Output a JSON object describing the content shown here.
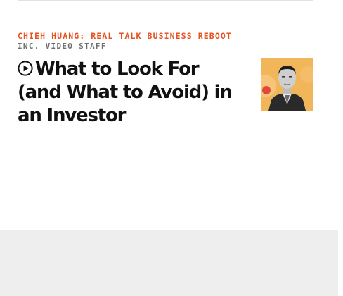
{
  "article": {
    "kicker": "CHIEH HUANG: REAL TALK BUSINESS REBOOT",
    "byline": "INC. VIDEO STAFF",
    "headline": "What to Look For (and What to Avoid) in an Investor",
    "media_type_icon": "play-circle-icon",
    "thumbnail_alt": "Chieh Huang"
  },
  "colors": {
    "kicker": "#e8501f",
    "byline": "#6e6e6e",
    "headline": "#111111",
    "thumb_background": "#f2b65a",
    "footer_band": "#eeeeee"
  }
}
